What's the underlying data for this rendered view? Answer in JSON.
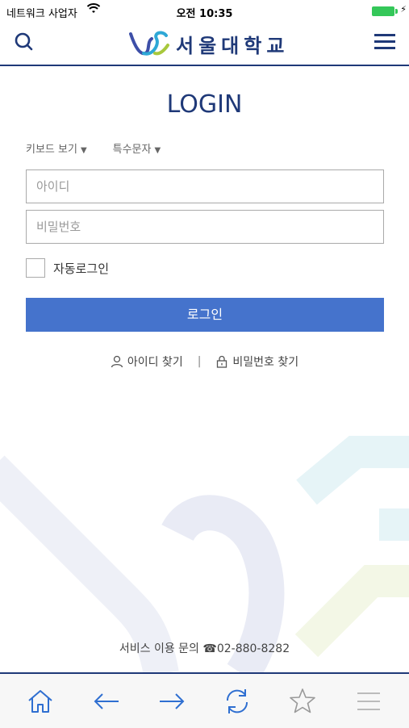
{
  "status_bar": {
    "carrier": "네트워크 사업자",
    "time": "오전 10:35"
  },
  "header": {
    "logo_text": "서울대학교"
  },
  "login": {
    "title": "LOGIN",
    "keyboard_label": "키보드 보기",
    "special_char_label": "특수문자",
    "id_placeholder": "아이디",
    "pw_placeholder": "비밀번호",
    "auto_login_label": "자동로그인",
    "login_button": "로그인",
    "find_id": "아이디 찾기",
    "separator": "|",
    "find_pw": "비밀번호 찾기"
  },
  "footer": {
    "contact_label": "서비스 이용 문의",
    "phone": "02-880-8282"
  },
  "colors": {
    "brand": "#1f3978",
    "button": "#4573cc",
    "icon": "#2f6fd1"
  },
  "toolbar": {
    "icons": [
      "home-icon",
      "back-arrow-icon",
      "forward-arrow-icon",
      "refresh-icon",
      "star-icon",
      "list-icon"
    ]
  }
}
